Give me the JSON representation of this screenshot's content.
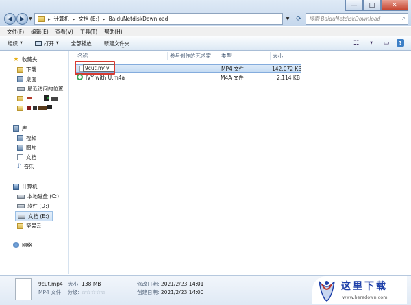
{
  "address": {
    "crumbs": [
      "计算机",
      "文档 (E:)",
      "BaiduNetdiskDownload"
    ]
  },
  "search": {
    "placeholder": "搜索 BaiduNetdiskDownload"
  },
  "window_controls": {
    "minimize": "—",
    "maximize": "□",
    "close": "✕"
  },
  "menu": [
    "文件(F)",
    "编辑(E)",
    "查看(V)",
    "工具(T)",
    "帮助(H)"
  ],
  "toolbar": {
    "organize": "组织",
    "open": "打开",
    "play_all": "全部播放",
    "new_folder": "新建文件夹"
  },
  "nav": {
    "favorites": "收藏夹",
    "downloads": "下载",
    "desktop": "桌面",
    "recent": "最近访问的位置",
    "libraries": "库",
    "videos": "视频",
    "pictures": "图片",
    "documents": "文档",
    "music": "音乐",
    "computer": "计算机",
    "drive_c": "本地磁盘 (C:)",
    "drive_d": "软件 (D:)",
    "drive_e": "文档 (E:)",
    "nutstore": "坚果云",
    "network": "网络"
  },
  "columns": {
    "name": "名称",
    "artists": "参与创作的艺术家",
    "type": "类型",
    "size": "大小"
  },
  "files": [
    {
      "name": "9cut.m4v",
      "type": "MP4 文件",
      "size": "142,072 KB"
    },
    {
      "name": "IVY with U.m4a",
      "type": "M4A 文件",
      "size": "2,114 KB"
    }
  ],
  "details": {
    "filename": "9cut.mp4",
    "size_label": "大小:",
    "size_value": "138 MB",
    "type": "MP4 文件",
    "rating_label": "分级:",
    "rating_stars": "☆☆☆☆☆",
    "modified_label": "修改日期:",
    "modified_value": "2021/2/23 14:01",
    "created_label": "创建日期:",
    "created_value": "2021/2/23 14:00"
  },
  "watermark": {
    "cn": "这里下载",
    "url": "www.heredown.com"
  },
  "colors": {
    "selection": "#cfe2f6",
    "highlight_box": "#d73a31",
    "accent": "#3c7fc6"
  }
}
